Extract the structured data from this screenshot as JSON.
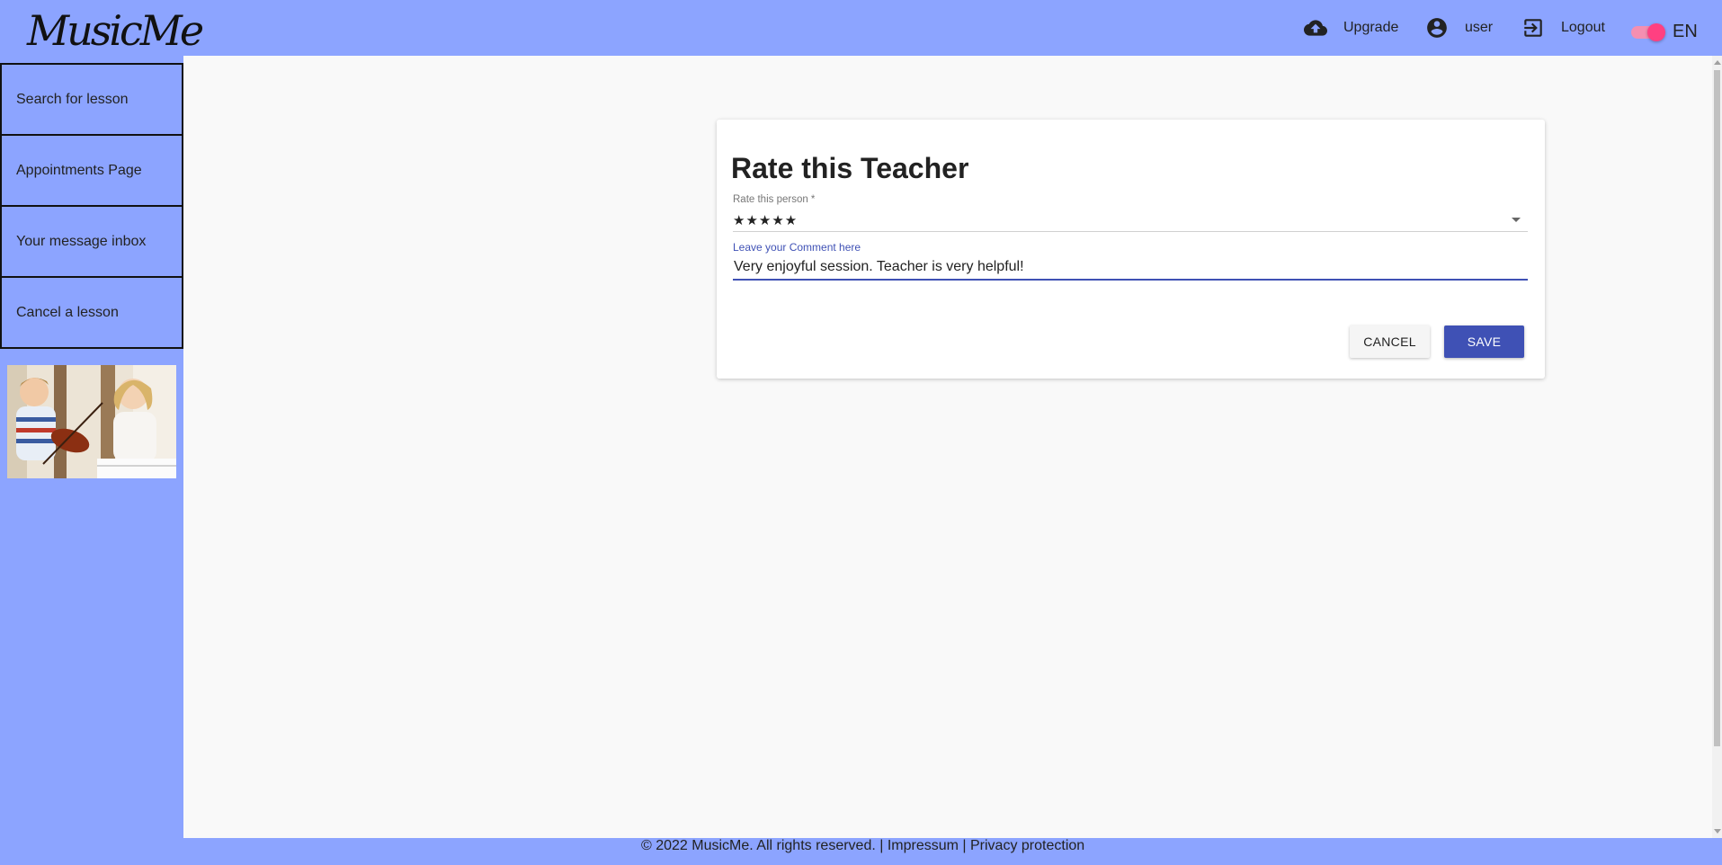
{
  "app": {
    "logo_text": "MusicMe"
  },
  "topnav": {
    "upgrade_label": "Upgrade",
    "user_label": "user",
    "logout_label": "Logout",
    "language": "EN"
  },
  "sidebar": {
    "items": [
      {
        "label": "Search for lesson"
      },
      {
        "label": "Appointments Page"
      },
      {
        "label": "Your message inbox"
      },
      {
        "label": "Cancel a lesson"
      }
    ]
  },
  "dialog": {
    "title": "Rate this Teacher",
    "rating_label": "Rate this person *",
    "rating_value": "★★★★★",
    "comment_label": "Leave your Comment here",
    "comment_value": "Very enjoyful session. Teacher is very helpful!",
    "cancel_label": "CANCEL",
    "save_label": "SAVE"
  },
  "footer": {
    "copyright": "© 2022 MusicMe. All rights reserved. | ",
    "impressum": "Impressum",
    "separator": " | ",
    "privacy": "Privacy protection"
  },
  "colors": {
    "brand_background": "#8ca4ff",
    "primary": "#3f51b5",
    "toggle_accent": "#ff4081",
    "content_background": "#f9f9f9"
  }
}
